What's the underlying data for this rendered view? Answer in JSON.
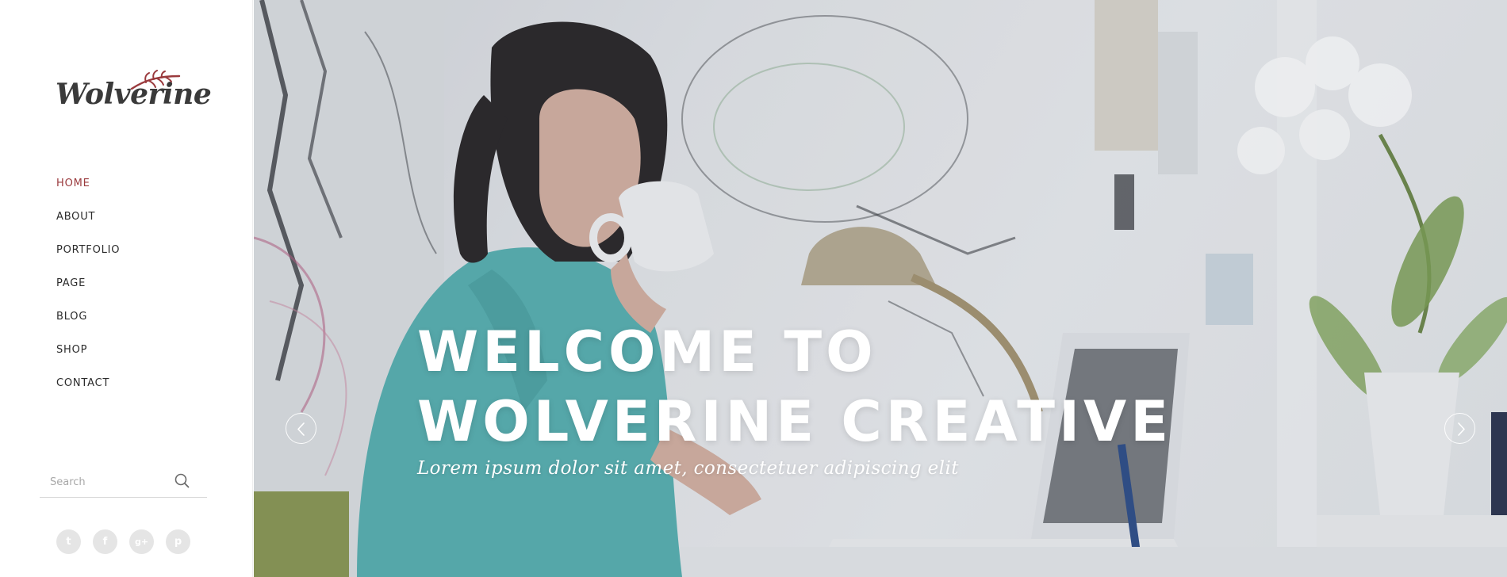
{
  "brand": {
    "name": "Wolverine",
    "accent_color": "#9a3a3d"
  },
  "nav": {
    "items": [
      {
        "label": "HOME",
        "active": true
      },
      {
        "label": "ABOUT",
        "active": false
      },
      {
        "label": "PORTFOLIO",
        "active": false
      },
      {
        "label": "PAGE",
        "active": false
      },
      {
        "label": "BLOG",
        "active": false
      },
      {
        "label": "SHOP",
        "active": false
      },
      {
        "label": "CONTACT",
        "active": false
      }
    ]
  },
  "search": {
    "placeholder": "Search",
    "value": "",
    "icon": "search-icon"
  },
  "social": [
    {
      "icon": "twitter-icon",
      "glyph": "t"
    },
    {
      "icon": "facebook-icon",
      "glyph": "f"
    },
    {
      "icon": "google-plus-icon",
      "glyph": "g+"
    },
    {
      "icon": "pinterest-icon",
      "glyph": "p"
    }
  ],
  "hero": {
    "title_line1": "WELCOME TO",
    "title_line2": "WOLVERINE CREATIVE",
    "subtitle": "Lorem ipsum dolor sit amet, consectetuer adipiscing elit",
    "prev_icon": "chevron-left-icon",
    "next_icon": "chevron-right-icon"
  }
}
